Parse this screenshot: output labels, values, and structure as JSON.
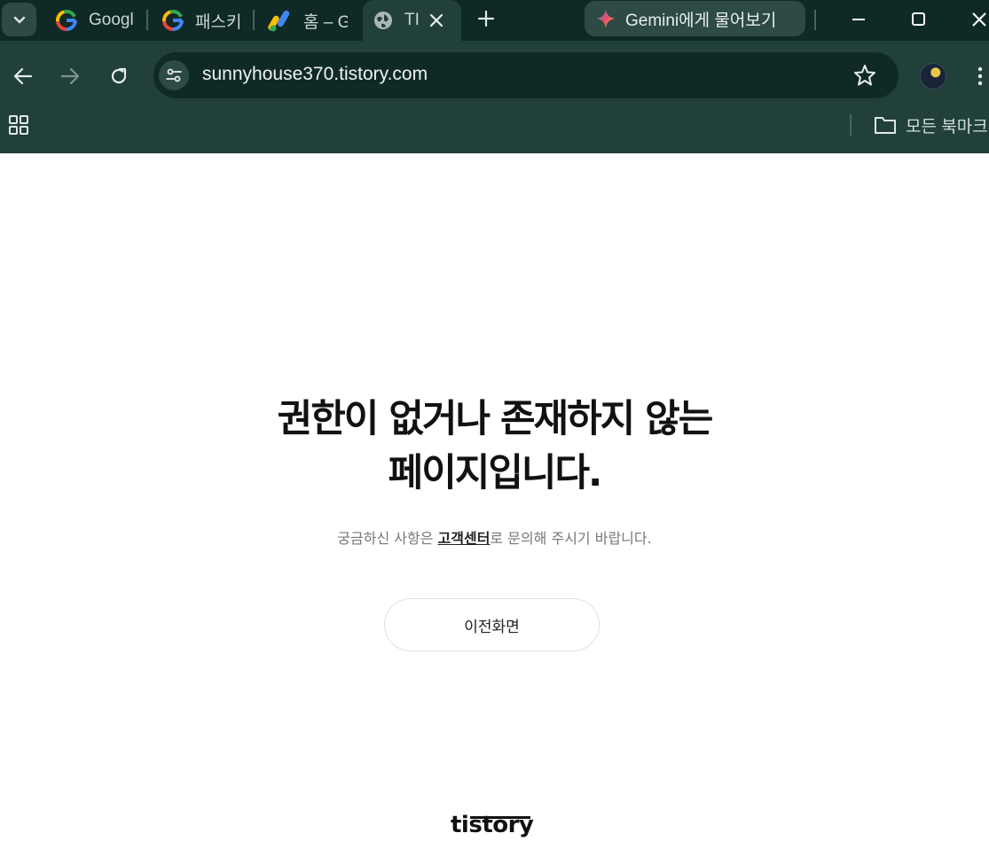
{
  "browser": {
    "tabs": [
      {
        "title": "Googl",
        "icon": "google-icon"
      },
      {
        "title": "패스키",
        "icon": "google-icon"
      },
      {
        "title": "홈 – G",
        "icon": "adsense-icon"
      },
      {
        "title": "TI",
        "icon": "globe-icon",
        "active": true
      }
    ],
    "gemini_label": "Gemini에게 물어보기",
    "url": "sunnyhouse370.tistory.com",
    "bookmarks_label": "모든 북마크"
  },
  "page": {
    "headline_line1": "권한이 없거나 존재하지 않는",
    "headline_line2": "페이지입니다.",
    "subtext_before": "궁금하신 사항은 ",
    "subtext_link": "고객센터",
    "subtext_after": "로 문의해 주시기 바랍니다.",
    "back_button": "이전화면",
    "logo": "tistory"
  },
  "colors": {
    "chrome_toolbar": "#21403a",
    "chrome_tabstrip": "#0f2a26",
    "headline": "#111111",
    "subtext": "#777777"
  }
}
